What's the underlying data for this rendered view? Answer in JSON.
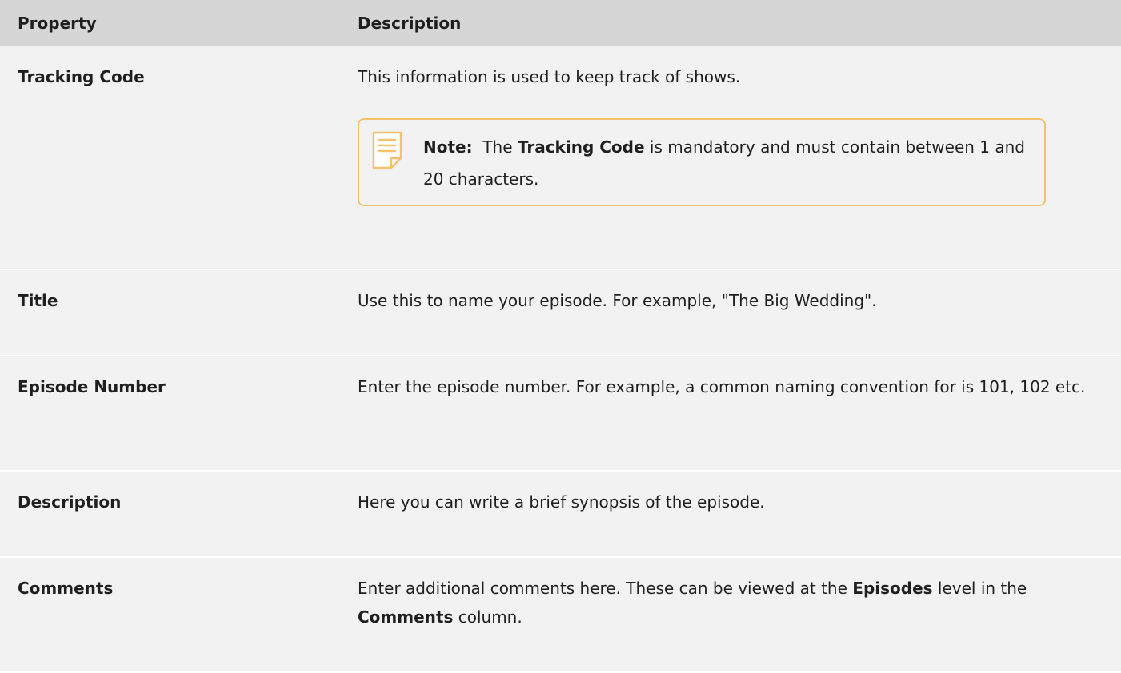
{
  "table": {
    "headers": {
      "property": "Property",
      "description": "Description"
    },
    "rows": [
      {
        "property": "Tracking Code",
        "description": "This information is used to keep track of shows.",
        "note": {
          "label": "Note:",
          "pre": "The",
          "bold": "Tracking Code",
          "post": "is mandatory and must contain between 1 and 20 characters."
        }
      },
      {
        "property": "Title",
        "description": "Use this to name your episode. For example, \"The Big Wedding\"."
      },
      {
        "property": "Episode Number",
        "description": "Enter the episode number. For example, a common naming convention for is 101, 102 etc."
      },
      {
        "property": "Description",
        "description": "Here you can write a brief synopsis of the episode."
      },
      {
        "property": "Comments",
        "description_parts": {
          "p1": "Enter additional comments here. These can be viewed at the",
          "b1": "Episodes",
          "p2": "level in the",
          "b2": "Comments",
          "p3": "column."
        }
      }
    ]
  },
  "icons": {
    "note": "note-icon"
  },
  "colors": {
    "header_bg": "#d6d6d6",
    "row_bg": "#f2f2f2",
    "note_border": "#f5c26b"
  }
}
